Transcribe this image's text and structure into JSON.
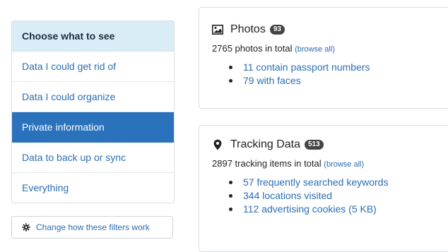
{
  "filters": {
    "header": "Choose what to see",
    "items": [
      {
        "label": "Data I could get rid of"
      },
      {
        "label": "Data I could organize"
      },
      {
        "label": "Private information"
      },
      {
        "label": "Data to back up or sync"
      },
      {
        "label": "Everything"
      }
    ],
    "active_index": 2,
    "change_button": "Change how these filters work"
  },
  "photos": {
    "icon": "image-icon",
    "title": "Photos",
    "badge": "93",
    "summary": "2765 photos in total",
    "browse_prefix": "(",
    "browse": "browse all",
    "browse_suffix": ")",
    "items": [
      {
        "label": "11 contain passport numbers"
      },
      {
        "label": "79 with faces"
      }
    ]
  },
  "tracking": {
    "icon": "map-marker-icon",
    "title": "Tracking Data",
    "badge": "513",
    "summary": "2897 tracking items in total",
    "browse_prefix": "(",
    "browse": "browse all",
    "browse_suffix": ")",
    "items": [
      {
        "label": "57 frequently searched keywords"
      },
      {
        "label": "344 locations visited"
      },
      {
        "label": "112 advertising cookies (5 KB)"
      }
    ]
  },
  "colors": {
    "link": "#2a6eb4",
    "active_bg": "#2a72bb",
    "header_bg": "#d9edf7",
    "badge_bg": "#444444"
  }
}
